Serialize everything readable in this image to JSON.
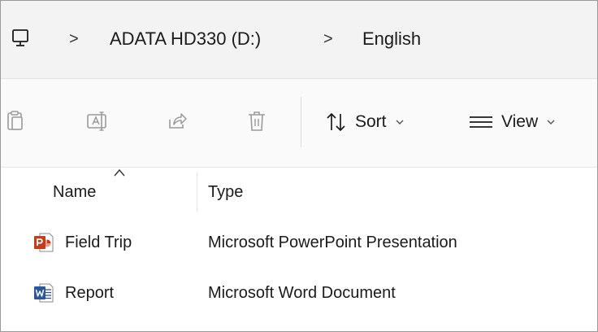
{
  "breadcrumb": {
    "root_icon": "this-pc-icon",
    "separator": ">",
    "items": [
      {
        "label": "ADATA HD330 (D:)"
      },
      {
        "label": "English"
      }
    ]
  },
  "commandbar": {
    "icons": [
      "paste-icon",
      "rename-icon",
      "share-icon",
      "delete-icon"
    ],
    "sort": {
      "label": "Sort",
      "icon": "sort-icon"
    },
    "view": {
      "label": "View",
      "icon": "view-icon"
    }
  },
  "columns": {
    "name": "Name",
    "type": "Type",
    "sorted_by": "Name"
  },
  "files": [
    {
      "name": "Field Trip",
      "type": "Microsoft PowerPoint Presentation",
      "icon": "powerpoint-file-icon"
    },
    {
      "name": "Report",
      "type": "Microsoft Word Document",
      "icon": "word-file-icon"
    }
  ],
  "colors": {
    "powerpoint": "#c43e1c",
    "word": "#2b579a",
    "toolbar_icon": "#9a9a9a"
  }
}
